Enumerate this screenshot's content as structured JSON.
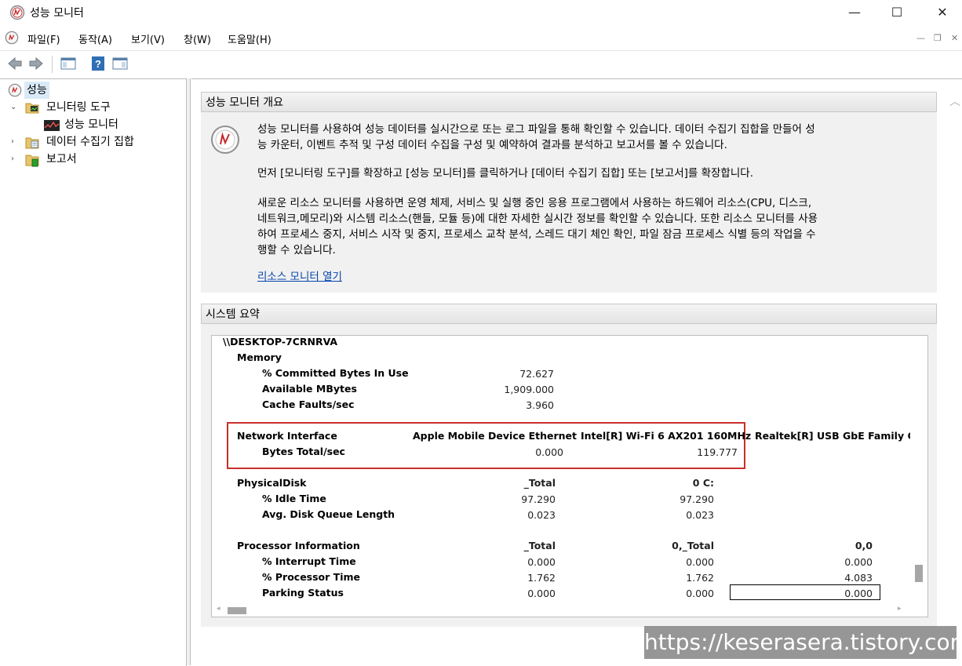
{
  "window": {
    "title": "성능 모니터",
    "minimize": "—",
    "maximize": "☐",
    "close": "✕"
  },
  "menu": {
    "items": [
      "파일(F)",
      "동작(A)",
      "보기(V)",
      "창(W)",
      "도움말(H)"
    ]
  },
  "tree": {
    "root": "성능",
    "monitoring_tools": "모니터링 도구",
    "performance_monitor": "성능 모니터",
    "data_collector_sets": "데이터 수집기 집합",
    "reports": "보고서"
  },
  "overview": {
    "header": "성능 모니터 개요",
    "para1_line1": "성능 모니터를 사용하여 성능 데이터를 실시간으로 또는 로그 파일을 통해 확인할 수 있습니다. 데이터 수집기 집합을 만들어 성",
    "para1_line2": "능 카운터, 이벤트 추적 및 구성 데이터 수집을 구성 및 예약하여 결과를 분석하고 보고서를 볼 수 있습니다.",
    "para2": "먼저 [모니터링 도구]를 확장하고 [성능 모니터]를 클릭하거나 [데이터 수집기 집합] 또는 [보고서]를 확장합니다.",
    "para3_line1": "새로운 리소스 모니터를 사용하면 운영 체제, 서비스 및 실행 중인 응용 프로그램에서 사용하는 하드웨어 리소스(CPU, 디스크,",
    "para3_line2": "네트워크,메모리)와 시스템 리소스(핸들, 모듈 등)에 대한 자세한 실시간 정보를 확인할 수 있습니다. 또한 리소스 모니터를 사용",
    "para3_line3": "하여 프로세스 중지, 서비스 시작 및 중지, 프로세스 교착 분석, 스레드 대기 체인 확인, 파일 잠금 프로세스 식별 등의 작업을 수",
    "para3_line4": "행할 수 있습니다.",
    "link": "리소스 모니터 열기"
  },
  "summary": {
    "header": "시스템 요약",
    "host": "\\\\DESKTOP-7CRNRVA",
    "memory": {
      "label": "Memory",
      "rows": [
        {
          "name": "% Committed Bytes In Use",
          "value": "72.627"
        },
        {
          "name": "Available MBytes",
          "value": "1,909.000"
        },
        {
          "name": "Cache Faults/sec",
          "value": "3.960"
        }
      ]
    },
    "network": {
      "label": "Network Interface",
      "col1": "Apple Mobile Device Ethernet",
      "col2": "Intel[R] Wi-Fi 6 AX201 160MHz",
      "col3": "Realtek[R] USB GbE Family Cor",
      "row_name": "Bytes Total/sec",
      "v1": "0.000",
      "v2": "119.777"
    },
    "disk": {
      "label": "PhysicalDisk",
      "col1": "_Total",
      "col2": "0 C:",
      "rows": [
        {
          "name": "% Idle Time",
          "v1": "97.290",
          "v2": "97.290"
        },
        {
          "name": "Avg. Disk Queue Length",
          "v1": "0.023",
          "v2": "0.023"
        }
      ]
    },
    "processor": {
      "label": "Processor Information",
      "col1": "_Total",
      "col2": "0,_Total",
      "col3": "0,0",
      "rows": [
        {
          "name": "% Interrupt Time",
          "v1": "0.000",
          "v2": "0.000",
          "v3": "0.000"
        },
        {
          "name": "% Processor Time",
          "v1": "1.762",
          "v2": "1.762",
          "v3": "4.083"
        },
        {
          "name": "Parking Status",
          "v1": "0.000",
          "v2": "0.000",
          "v3": "0.000"
        }
      ]
    }
  },
  "watermark": "https://keserasera.tistory.com"
}
